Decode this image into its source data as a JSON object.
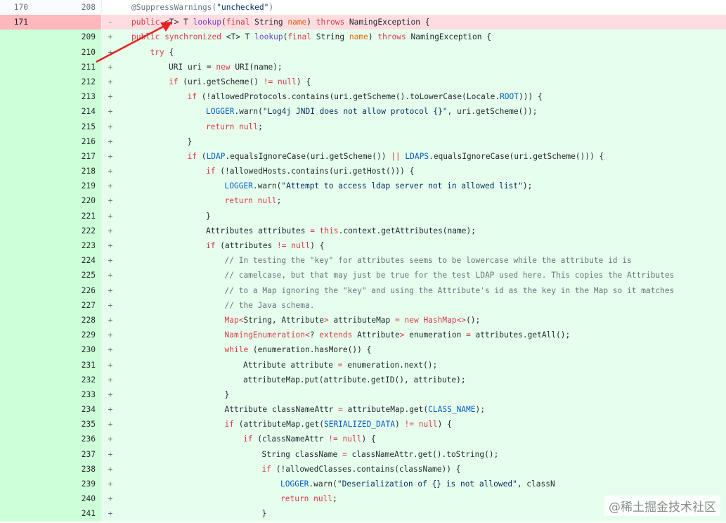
{
  "diff": {
    "rows": [
      {
        "type": "ctx",
        "old": "170",
        "new": "208",
        "marker": "",
        "indent": 0,
        "tokens": [
          [
            "@SuppressWarnings(",
            "c"
          ],
          [
            "\"unchecked\"",
            "s"
          ],
          [
            ")",
            "c"
          ]
        ]
      },
      {
        "type": "del",
        "old": "171",
        "new": "",
        "marker": "-",
        "indent": 0,
        "tokens": [
          [
            "public ",
            "k"
          ],
          [
            "<T> T ",
            ""
          ],
          [
            "lookup",
            "f"
          ],
          [
            "(",
            ""
          ],
          [
            "final ",
            "k"
          ],
          [
            "String ",
            ""
          ],
          [
            "name",
            "p"
          ],
          [
            ") ",
            ""
          ],
          [
            "throws ",
            "k"
          ],
          [
            "NamingException {",
            ""
          ]
        ]
      },
      {
        "type": "add",
        "old": "",
        "new": "209",
        "marker": "+",
        "indent": 0,
        "tokens": [
          [
            "public ",
            "k"
          ],
          [
            "synchronized ",
            "k"
          ],
          [
            "<T> T ",
            ""
          ],
          [
            "lookup",
            "f"
          ],
          [
            "(",
            ""
          ],
          [
            "final ",
            "k"
          ],
          [
            "String ",
            ""
          ],
          [
            "name",
            "p"
          ],
          [
            ") ",
            ""
          ],
          [
            "throws ",
            "k"
          ],
          [
            "NamingException {",
            ""
          ]
        ]
      },
      {
        "type": "add",
        "old": "",
        "new": "210",
        "marker": "+",
        "indent": 1,
        "tokens": [
          [
            "try ",
            "k"
          ],
          [
            "{",
            ""
          ]
        ]
      },
      {
        "type": "add",
        "old": "",
        "new": "211",
        "marker": "+",
        "indent": 2,
        "tokens": [
          [
            "URI uri = ",
            ""
          ],
          [
            "new ",
            "k"
          ],
          [
            "URI(name);",
            ""
          ]
        ]
      },
      {
        "type": "add",
        "old": "",
        "new": "212",
        "marker": "+",
        "indent": 2,
        "tokens": [
          [
            "if ",
            "k"
          ],
          [
            "(uri.getScheme() ",
            ""
          ],
          [
            "!= ",
            "k"
          ],
          [
            "null",
            "k"
          ],
          [
            ") {",
            ""
          ]
        ]
      },
      {
        "type": "add",
        "old": "",
        "new": "213",
        "marker": "+",
        "indent": 3,
        "tokens": [
          [
            "if ",
            "k"
          ],
          [
            "(!allowedProtocols.contains(uri.getScheme().toLowerCase(Locale.",
            ""
          ],
          [
            "ROOT",
            "v"
          ],
          [
            "))) {",
            ""
          ]
        ]
      },
      {
        "type": "add",
        "old": "",
        "new": "214",
        "marker": "+",
        "indent": 4,
        "tokens": [
          [
            "LOGGER",
            "v"
          ],
          [
            ".warn(",
            ""
          ],
          [
            "\"Log4j JNDI does not allow protocol {}\"",
            "s"
          ],
          [
            ", uri.getScheme());",
            ""
          ]
        ]
      },
      {
        "type": "add",
        "old": "",
        "new": "215",
        "marker": "+",
        "indent": 4,
        "tokens": [
          [
            "return ",
            "k"
          ],
          [
            "null",
            "k"
          ],
          [
            ";",
            ""
          ]
        ]
      },
      {
        "type": "add",
        "old": "",
        "new": "216",
        "marker": "+",
        "indent": 3,
        "tokens": [
          [
            "}",
            ""
          ]
        ]
      },
      {
        "type": "add",
        "old": "",
        "new": "217",
        "marker": "+",
        "indent": 3,
        "tokens": [
          [
            "if ",
            "k"
          ],
          [
            "(",
            ""
          ],
          [
            "LDAP",
            "v"
          ],
          [
            ".equalsIgnoreCase(uri.getScheme()) ",
            ""
          ],
          [
            "|| ",
            "k"
          ],
          [
            "LDAPS",
            "v"
          ],
          [
            ".equalsIgnoreCase(uri.getScheme())) {",
            ""
          ]
        ]
      },
      {
        "type": "add",
        "old": "",
        "new": "218",
        "marker": "+",
        "indent": 4,
        "tokens": [
          [
            "if ",
            "k"
          ],
          [
            "(!allowedHosts.contains(uri.getHost())) {",
            ""
          ]
        ]
      },
      {
        "type": "add",
        "old": "",
        "new": "219",
        "marker": "+",
        "indent": 5,
        "tokens": [
          [
            "LOGGER",
            "v"
          ],
          [
            ".warn(",
            ""
          ],
          [
            "\"Attempt to access ldap server not in allowed list\"",
            "s"
          ],
          [
            ");",
            ""
          ]
        ]
      },
      {
        "type": "add",
        "old": "",
        "new": "220",
        "marker": "+",
        "indent": 5,
        "tokens": [
          [
            "return ",
            "k"
          ],
          [
            "null",
            "k"
          ],
          [
            ";",
            ""
          ]
        ]
      },
      {
        "type": "add",
        "old": "",
        "new": "221",
        "marker": "+",
        "indent": 4,
        "tokens": [
          [
            "}",
            ""
          ]
        ]
      },
      {
        "type": "add",
        "old": "",
        "new": "222",
        "marker": "+",
        "indent": 4,
        "tokens": [
          [
            "Attributes attributes ",
            ""
          ],
          [
            "= ",
            "k"
          ],
          [
            "this",
            "k"
          ],
          [
            ".context.getAttributes(name);",
            ""
          ]
        ]
      },
      {
        "type": "add",
        "old": "",
        "new": "223",
        "marker": "+",
        "indent": 4,
        "tokens": [
          [
            "if ",
            "k"
          ],
          [
            "(attributes ",
            ""
          ],
          [
            "!= ",
            "k"
          ],
          [
            "null",
            "k"
          ],
          [
            ") {",
            ""
          ]
        ]
      },
      {
        "type": "add",
        "old": "",
        "new": "224",
        "marker": "+",
        "indent": 5,
        "tokens": [
          [
            "// In testing the \"key\" for attributes seems to be lowercase while the attribute id is",
            "c"
          ]
        ]
      },
      {
        "type": "add",
        "old": "",
        "new": "225",
        "marker": "+",
        "indent": 5,
        "tokens": [
          [
            "// camelcase, but that may just be true for the test LDAP used here. This copies the Attributes",
            "c"
          ]
        ]
      },
      {
        "type": "add",
        "old": "",
        "new": "226",
        "marker": "+",
        "indent": 5,
        "tokens": [
          [
            "// to a Map ignoring the \"key\" and using the Attribute's id as the key in the Map so it matches",
            "c"
          ]
        ]
      },
      {
        "type": "add",
        "old": "",
        "new": "227",
        "marker": "+",
        "indent": 5,
        "tokens": [
          [
            "// the Java schema.",
            "c"
          ]
        ]
      },
      {
        "type": "add",
        "old": "",
        "new": "228",
        "marker": "+",
        "indent": 5,
        "tokens": [
          [
            "Map<",
            "k"
          ],
          [
            "String, Attribute",
            ""
          ],
          [
            "> ",
            "k"
          ],
          [
            "attributeMap ",
            ""
          ],
          [
            "= new ",
            "k"
          ],
          [
            "HashMap<>",
            "k"
          ],
          [
            "();",
            ""
          ]
        ]
      },
      {
        "type": "add",
        "old": "",
        "new": "229",
        "marker": "+",
        "indent": 5,
        "tokens": [
          [
            "NamingEnumeration<",
            "k"
          ],
          [
            "? ",
            ""
          ],
          [
            "extends ",
            "k"
          ],
          [
            "Attribute",
            ""
          ],
          [
            "> ",
            "k"
          ],
          [
            "enumeration ",
            ""
          ],
          [
            "= ",
            "k"
          ],
          [
            "attributes.getAll();",
            ""
          ]
        ]
      },
      {
        "type": "add",
        "old": "",
        "new": "230",
        "marker": "+",
        "indent": 5,
        "tokens": [
          [
            "while ",
            "k"
          ],
          [
            "(enumeration.hasMore()) {",
            ""
          ]
        ]
      },
      {
        "type": "add",
        "old": "",
        "new": "231",
        "marker": "+",
        "indent": 6,
        "tokens": [
          [
            "Attribute attribute ",
            ""
          ],
          [
            "= ",
            "k"
          ],
          [
            "enumeration.next();",
            ""
          ]
        ]
      },
      {
        "type": "add",
        "old": "",
        "new": "232",
        "marker": "+",
        "indent": 6,
        "tokens": [
          [
            "attributeMap.put(attribute.getID(), attribute);",
            ""
          ]
        ]
      },
      {
        "type": "add",
        "old": "",
        "new": "233",
        "marker": "+",
        "indent": 5,
        "tokens": [
          [
            "}",
            ""
          ]
        ]
      },
      {
        "type": "add",
        "old": "",
        "new": "234",
        "marker": "+",
        "indent": 5,
        "tokens": [
          [
            "Attribute classNameAttr ",
            ""
          ],
          [
            "= ",
            "k"
          ],
          [
            "attributeMap.get(",
            ""
          ],
          [
            "CLASS_NAME",
            "v"
          ],
          [
            ");",
            ""
          ]
        ]
      },
      {
        "type": "add",
        "old": "",
        "new": "235",
        "marker": "+",
        "indent": 5,
        "tokens": [
          [
            "if ",
            "k"
          ],
          [
            "(attributeMap.get(",
            ""
          ],
          [
            "SERIALIZED_DATA",
            "v"
          ],
          [
            ") ",
            ""
          ],
          [
            "!= ",
            "k"
          ],
          [
            "null",
            "k"
          ],
          [
            ") {",
            ""
          ]
        ]
      },
      {
        "type": "add",
        "old": "",
        "new": "236",
        "marker": "+",
        "indent": 6,
        "tokens": [
          [
            "if ",
            "k"
          ],
          [
            "(classNameAttr ",
            ""
          ],
          [
            "!= ",
            "k"
          ],
          [
            "null",
            "k"
          ],
          [
            ") {",
            ""
          ]
        ]
      },
      {
        "type": "add",
        "old": "",
        "new": "237",
        "marker": "+",
        "indent": 7,
        "tokens": [
          [
            "String className ",
            ""
          ],
          [
            "= ",
            "k"
          ],
          [
            "classNameAttr.get().toString();",
            ""
          ]
        ]
      },
      {
        "type": "add",
        "old": "",
        "new": "238",
        "marker": "+",
        "indent": 7,
        "tokens": [
          [
            "if ",
            "k"
          ],
          [
            "(!allowedClasses.contains(className)) {",
            ""
          ]
        ]
      },
      {
        "type": "add",
        "old": "",
        "new": "239",
        "marker": "+",
        "indent": 8,
        "tokens": [
          [
            "LOGGER",
            "v"
          ],
          [
            ".warn(",
            ""
          ],
          [
            "\"Deserialization of {} is not allowed\"",
            "s"
          ],
          [
            ", classN",
            ""
          ]
        ]
      },
      {
        "type": "add",
        "old": "",
        "new": "240",
        "marker": "+",
        "indent": 8,
        "tokens": [
          [
            "return ",
            "k"
          ],
          [
            "null",
            "k"
          ],
          [
            ";",
            ""
          ]
        ]
      },
      {
        "type": "add",
        "old": "",
        "new": "241",
        "marker": "+",
        "indent": 7,
        "tokens": [
          [
            "}",
            ""
          ]
        ]
      }
    ]
  },
  "colors": {
    "deleted_row": "#ffdce0",
    "added_row": "#e6ffed",
    "annotation_arrow": "#e8211f"
  },
  "annotation": {
    "icon": "red-arrow-icon"
  },
  "watermark": {
    "text": "@稀土掘金技术社区"
  }
}
